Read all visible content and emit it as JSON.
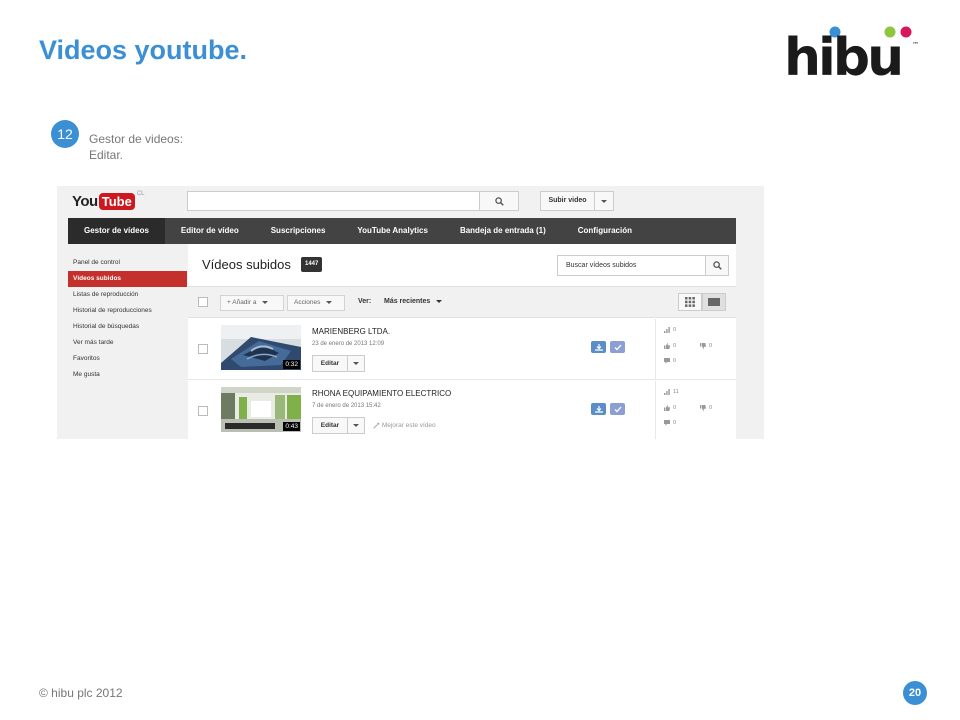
{
  "slide": {
    "title": "Videos youtube.",
    "step_number": "12",
    "step_line1": "Gestor de videos:",
    "step_line2": "Editar.",
    "footer": "© hibu plc 2012",
    "page_number": "20",
    "logo_text": "hibu",
    "logo_tm": "™",
    "brand_colors": {
      "blue": "#3b8fd4",
      "red": "#c4302b",
      "logo_dark": "#1a1a1a"
    }
  },
  "youtube": {
    "logo_you": "You",
    "logo_tube": "Tube",
    "logo_country": "CL",
    "upload_label": "Subir video",
    "nav": [
      {
        "label": "Gestor de vídeos",
        "active": true
      },
      {
        "label": "Editor de vídeo",
        "active": false
      },
      {
        "label": "Suscripciones",
        "active": false
      },
      {
        "label": "YouTube Analytics",
        "active": false
      },
      {
        "label": "Bandeja de entrada (1)",
        "active": false
      },
      {
        "label": "Configuración",
        "active": false
      }
    ],
    "sidebar": [
      {
        "label": "Panel de control",
        "active": false
      },
      {
        "label": "Vídeos subidos",
        "active": true
      },
      {
        "label": "Listas de reproducción",
        "active": false
      },
      {
        "label": "Historial de reproducciones",
        "active": false
      },
      {
        "label": "Historial de búsquedas",
        "active": false
      },
      {
        "label": "Ver más tarde",
        "active": false
      },
      {
        "label": "Favoritos",
        "active": false
      },
      {
        "label": "Me gusta",
        "active": false
      }
    ],
    "main": {
      "title": "Vídeos subidos",
      "count": "1447",
      "search_placeholder": "Buscar vídeos subidos",
      "add_to_label": "+ Añadir a",
      "actions_label": "Acciones",
      "view_label": "Ver:",
      "sort_label": "Más recientes"
    },
    "videos": [
      {
        "title": "MARIENBERG LTDA.",
        "date": "23 de enero de 2013 12:09",
        "duration": "0:32",
        "edit_label": "Editar",
        "improve_label": "",
        "views": "0",
        "likes": "0",
        "dislikes": "0",
        "comments": "0"
      },
      {
        "title": "RHONA EQUIPAMIENTO ELECTRICO",
        "date": "7 de enero de 2013 15:42",
        "duration": "0:43",
        "edit_label": "Editar",
        "improve_label": "Mejorar este vídeo",
        "views": "11",
        "likes": "0",
        "dislikes": "0",
        "comments": "0"
      }
    ]
  }
}
